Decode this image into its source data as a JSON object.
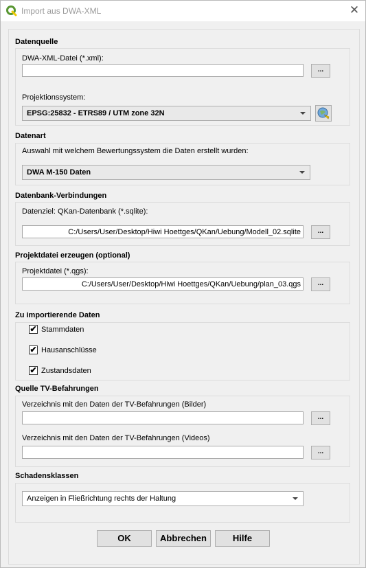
{
  "window": {
    "title": "Import aus DWA-XML",
    "close_symbol": "✕"
  },
  "datenquelle": {
    "heading": "Datenquelle",
    "xml_label": "DWA-XML-Datei (*.xml):",
    "xml_value": "",
    "browse": "...",
    "proj_label": "Projektionssystem:",
    "proj_value": "EPSG:25832 - ETRS89 / UTM zone 32N"
  },
  "datenart": {
    "heading": "Datenart",
    "label": "Auswahl mit welchem Bewertungssystem die Daten erstellt wurden:",
    "value": "DWA M-150 Daten"
  },
  "datenbank": {
    "heading": "Datenbank-Verbindungen",
    "label": "Datenziel: QKan-Datenbank (*.sqlite):",
    "value": "C:/Users/User/Desktop/Hiwi Hoettges/QKan/Uebung/Modell_02.sqlite",
    "browse": "..."
  },
  "projektdatei": {
    "heading": "Projektdatei erzeugen (optional)",
    "label": "Projektdatei (*.qgs):",
    "value": "C:/Users/User/Desktop/Hiwi Hoettges/QKan/Uebung/plan_03.qgs",
    "browse": "..."
  },
  "import_daten": {
    "heading": "Zu importierende Daten",
    "checkboxes": [
      {
        "label": "Stammdaten",
        "checked": true,
        "mark": "✔"
      },
      {
        "label": "Hausanschlüsse",
        "checked": true,
        "mark": "✔"
      },
      {
        "label": "Zustandsdaten",
        "checked": true,
        "mark": "✔"
      }
    ]
  },
  "tv": {
    "heading": "Quelle TV-Befahrungen",
    "bilder_label": "Verzeichnis mit den Daten der TV-Befahrungen (Bilder)",
    "bilder_value": "",
    "videos_label": "Verzeichnis mit den Daten der TV-Befahrungen (Videos)",
    "videos_value": "",
    "browse": "..."
  },
  "schadensklassen": {
    "heading": "Schadensklassen",
    "value": "Anzeigen in Fließrichtung rechts der Haltung"
  },
  "buttons": {
    "ok": "OK",
    "cancel": "Abbrechen",
    "help": "Hilfe"
  },
  "colors": {
    "qgis_green": "#589632",
    "qgis_yellow": "#eec900",
    "dialog_bg": "#f0f0f0"
  },
  "icons": {
    "app": "qgis-logo-icon",
    "crs": "crs-selector-icon"
  }
}
